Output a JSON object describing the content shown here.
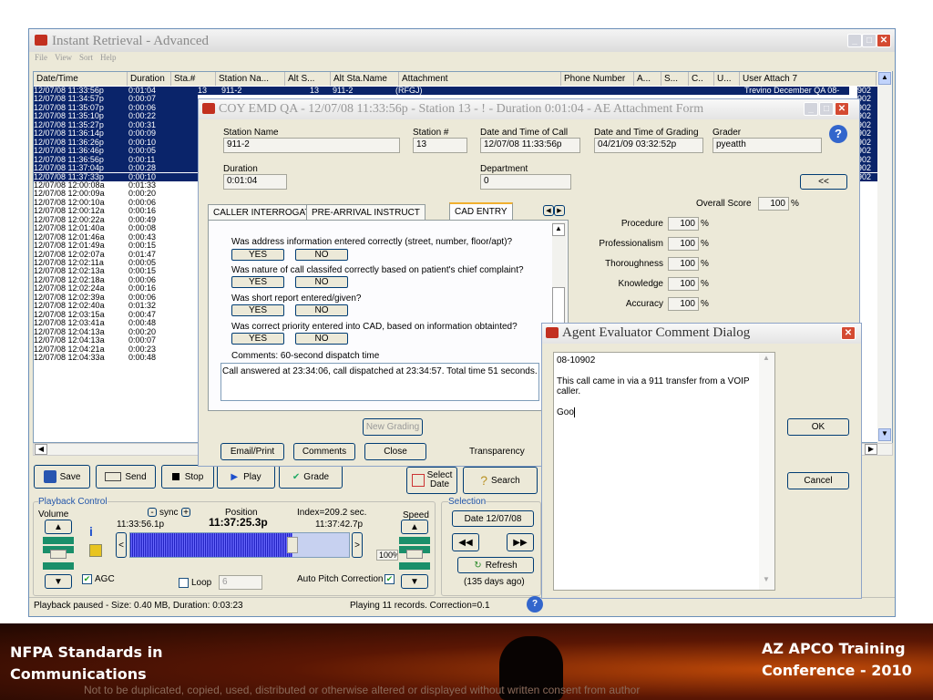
{
  "app": {
    "title": "Instant Retrieval - Advanced",
    "menu": [
      "File",
      "View",
      "Sort",
      "Help"
    ]
  },
  "table": {
    "headers": [
      "Date/Time",
      "Duration",
      "Sta.#",
      "Station Na...",
      "Alt S...",
      "Alt Sta.Name",
      "Attachment",
      "Phone Number",
      "A...",
      "S...",
      "C..",
      "U...",
      "User Attach 7"
    ],
    "first_row": {
      "station_no": "13",
      "station_name": "911-2",
      "alt_s": "13",
      "alt_name": "911-2",
      "attachment": "(RFGJ)",
      "user_attach": "Trevino December QA 08-10902"
    },
    "rows": [
      {
        "dt": "12/07/08 11:33:56p",
        "dur": "0:01:04",
        "tail": "902",
        "sel": true
      },
      {
        "dt": "12/07/08 11:34:57p",
        "dur": "0:00:07",
        "tail": "902",
        "sel": true
      },
      {
        "dt": "12/07/08 11:35:07p",
        "dur": "0:00:06",
        "tail": "902",
        "sel": true
      },
      {
        "dt": "12/07/08 11:35:10p",
        "dur": "0:00:22",
        "tail": "902",
        "sel": true
      },
      {
        "dt": "12/07/08 11:35:27p",
        "dur": "0:00:31",
        "tail": "902",
        "sel": true
      },
      {
        "dt": "12/07/08 11:36:14p",
        "dur": "0:00:09",
        "tail": "902",
        "sel": true
      },
      {
        "dt": "12/07/08 11:36:26p",
        "dur": "0:00:10",
        "tail": "902",
        "sel": true
      },
      {
        "dt": "12/07/08 11:36:46p",
        "dur": "0:00:05",
        "tail": "902",
        "sel": true
      },
      {
        "dt": "12/07/08 11:36:56p",
        "dur": "0:00:11",
        "tail": "902",
        "sel": true
      },
      {
        "dt": "12/07/08 11:37:04p",
        "dur": "0:00:28",
        "tail": "902",
        "sel": true
      },
      {
        "dt": "12/07/08 11:37:33p",
        "dur": "0:00:10",
        "tail": "902",
        "sel": true
      },
      {
        "dt": "12/07/08 12:00:08a",
        "dur": "0:01:33",
        "tail": "",
        "sel": false
      },
      {
        "dt": "12/07/08 12:00:09a",
        "dur": "0:00:20",
        "tail": "",
        "sel": false
      },
      {
        "dt": "12/07/08 12:00:10a",
        "dur": "0:00:06",
        "tail": "",
        "sel": false
      },
      {
        "dt": "12/07/08 12:00:12a",
        "dur": "0:00:16",
        "tail": "",
        "sel": false
      },
      {
        "dt": "12/07/08 12:00:22a",
        "dur": "0:00:49",
        "tail": "",
        "sel": false
      },
      {
        "dt": "12/07/08 12:01:40a",
        "dur": "0:00:08",
        "tail": "",
        "sel": false
      },
      {
        "dt": "12/07/08 12:01:46a",
        "dur": "0:00:43",
        "tail": "",
        "sel": false
      },
      {
        "dt": "12/07/08 12:01:49a",
        "dur": "0:00:15",
        "tail": "",
        "sel": false
      },
      {
        "dt": "12/07/08 12:02:07a",
        "dur": "0:01:47",
        "tail": "",
        "sel": false
      },
      {
        "dt": "12/07/08 12:02:11a",
        "dur": "0:00:05",
        "tail": "",
        "sel": false
      },
      {
        "dt": "12/07/08 12:02:13a",
        "dur": "0:00:15",
        "tail": "",
        "sel": false
      },
      {
        "dt": "12/07/08 12:02:18a",
        "dur": "0:00:06",
        "tail": "",
        "sel": false
      },
      {
        "dt": "12/07/08 12:02:24a",
        "dur": "0:00:16",
        "tail": "",
        "sel": false
      },
      {
        "dt": "12/07/08 12:02:39a",
        "dur": "0:00:06",
        "tail": "",
        "sel": false
      },
      {
        "dt": "12/07/08 12:02:40a",
        "dur": "0:01:32",
        "tail": "",
        "sel": false
      },
      {
        "dt": "12/07/08 12:03:15a",
        "dur": "0:00:47",
        "tail": "",
        "sel": false
      },
      {
        "dt": "12/07/08 12:03:41a",
        "dur": "0:00:48",
        "tail": "",
        "sel": false
      },
      {
        "dt": "12/07/08 12:04:13a",
        "dur": "0:00:20",
        "tail": "",
        "sel": false
      },
      {
        "dt": "12/07/08 12:04:13a",
        "dur": "0:00:07",
        "tail": "",
        "sel": false
      },
      {
        "dt": "12/07/08 12:04:21a",
        "dur": "0:00:23",
        "tail": "",
        "sel": false
      },
      {
        "dt": "12/07/08 12:04:33a",
        "dur": "0:00:48",
        "tail": "",
        "sel": false
      }
    ]
  },
  "toolbar": {
    "save": "Save",
    "send": "Send",
    "stop": "Stop",
    "play": "Play",
    "grade": "Grade",
    "select_date": "Select Date",
    "search": "Search"
  },
  "playback": {
    "group": "Playback Control",
    "volume": "Volume",
    "sync": "sync",
    "position": "Position",
    "position_value": "11:37:25.3p",
    "start": "11:33:56.1p",
    "end": "11:37:42.7p",
    "index": "Index=209.2 sec.",
    "speed": "Speed",
    "speed_pct": "100%",
    "agc": "AGC",
    "loop": "Loop",
    "loop_value": "6",
    "auto_pitch": "Auto Pitch Correction",
    "progress": 0.74
  },
  "selection": {
    "group": "Selection",
    "date": "Date 12/07/08",
    "refresh": "Refresh",
    "ago": "(135 days ago)"
  },
  "status": {
    "left": "Playback paused - Size: 0.40 MB, Duration: 0:03:23",
    "right": "Playing 11 records.  Correction=0.1"
  },
  "grading": {
    "title": "COY EMD QA - 12/07/08 11:33:56p - Station 13 - ! - Duration  0:01:04 - AE Attachment Form",
    "station_name_label": "Station Name",
    "station_name": "911-2",
    "station_no_label": "Station #",
    "station_no": "13",
    "call_dt_label": "Date and Time of Call",
    "call_dt": "12/07/08 11:33:56p",
    "grading_dt_label": "Date and Time of Grading",
    "grading_dt": "04/21/09 03:32:52p",
    "grader_label": "Grader",
    "grader": "pyeatth",
    "duration_label": "Duration",
    "duration": "0:01:04",
    "dept_label": "Department",
    "dept": "0",
    "collapse": "<<",
    "tabs": [
      "CALLER INTERROGATION",
      "PRE-ARRIVAL INSTRUCT",
      "CAD ENTRY"
    ],
    "questions": [
      {
        "q": "Was address information entered correctly (street, number, floor/apt)?",
        "yes": "YES",
        "no": "NO"
      },
      {
        "q": "Was nature of call classifed correctly based on patient's chief complaint?",
        "yes": "YES",
        "no": "NO"
      },
      {
        "q": "Was short report entered/given?",
        "yes": "YES",
        "no": "NO"
      },
      {
        "q": "Was correct priority entered into CAD, based on information obtainted?",
        "yes": "YES",
        "no": "NO"
      }
    ],
    "comments_label": "Comments: 60-second dispatch time",
    "comments": "Call answered at 23:34:06, call dispatched at 23:34:57. Total time 51 seconds.",
    "overall_label": "Overall Score",
    "overall": "100",
    "pct": "%",
    "scores": [
      {
        "label": "Procedure",
        "value": "100"
      },
      {
        "label": "Professionalism",
        "value": "100"
      },
      {
        "label": "Thoroughness",
        "value": "100"
      },
      {
        "label": "Knowledge",
        "value": "100"
      },
      {
        "label": "Accuracy",
        "value": "100"
      }
    ],
    "new_grading": "New Grading",
    "email": "Email/Print",
    "comments_btn": "Comments",
    "close": "Close",
    "transparency": "Transparency"
  },
  "comment_dialog": {
    "title": "Agent Evaluator Comment Dialog",
    "line1": "08-10902",
    "line2": "This call came in via a 911 transfer from a VOIP caller.",
    "line3": "Goo",
    "ok": "OK",
    "cancel": "Cancel"
  },
  "banner": {
    "left1": "NFPA Standards in",
    "left2": "Communications",
    "right1": "AZ APCO Training",
    "right2": "Conference - 2010",
    "footer": "Not to be duplicated, copied, used, distributed or otherwise altered or displayed without written consent from author"
  },
  "colors": {
    "selection": "#0a246a",
    "title_blue": "#0054e3",
    "banner": "#2a0c02"
  }
}
